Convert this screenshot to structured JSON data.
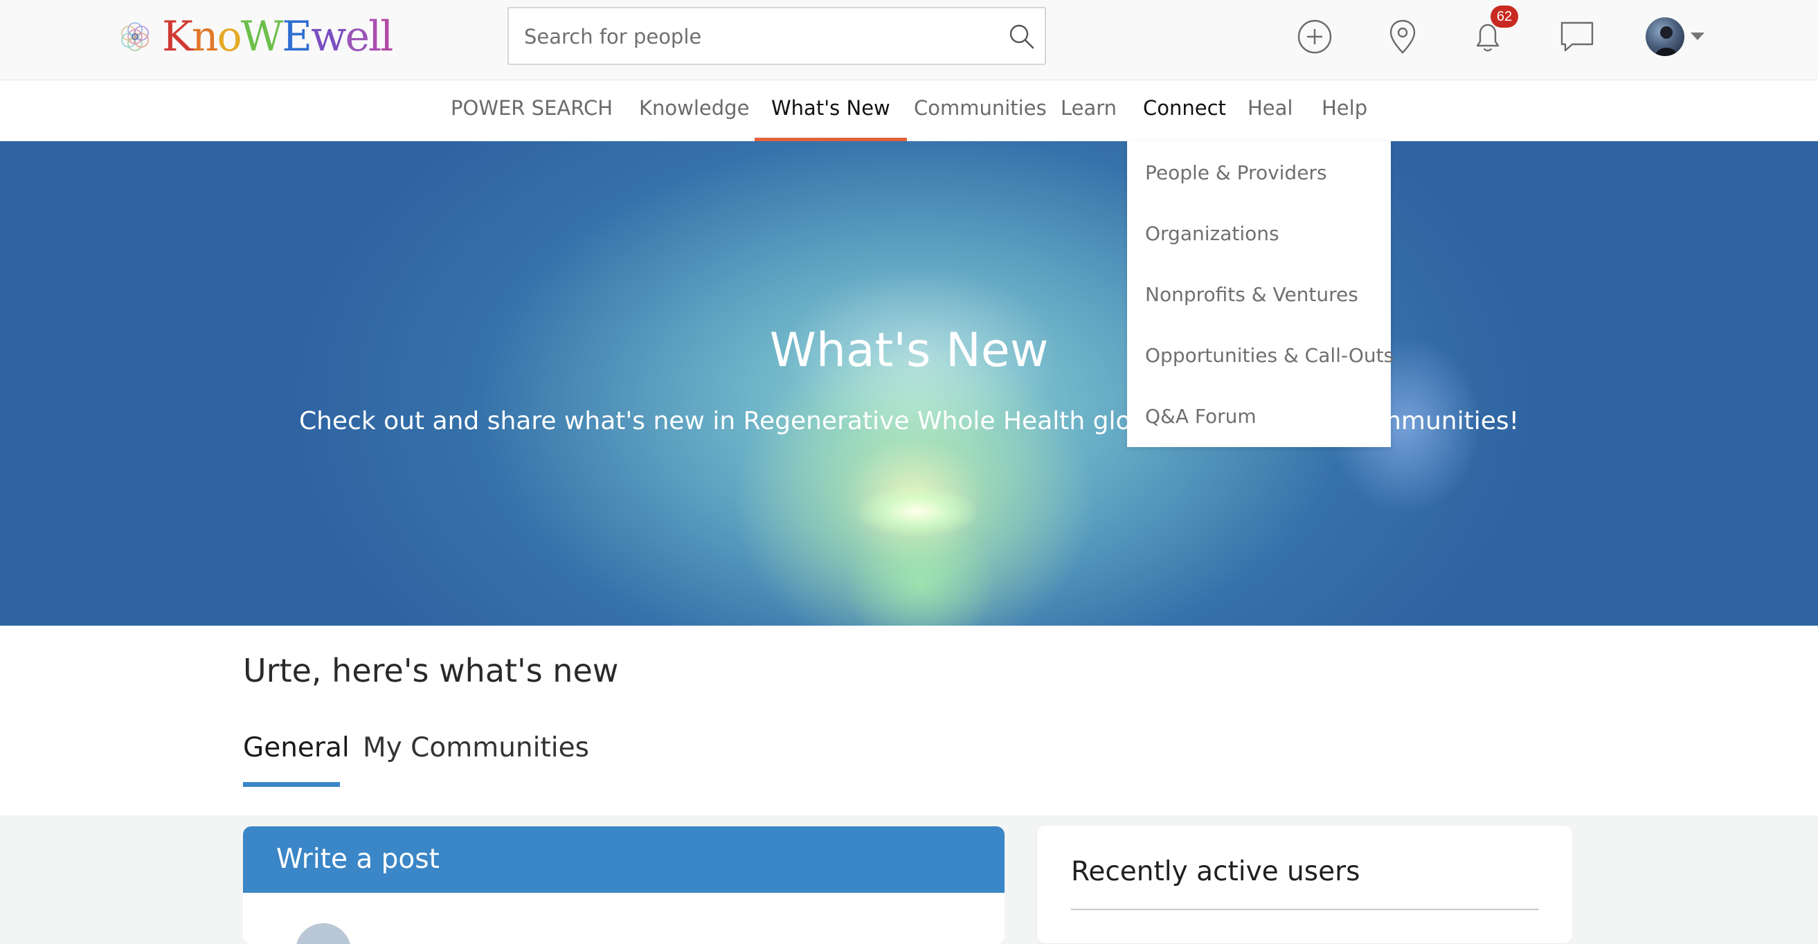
{
  "header": {
    "logo_text": "KnoWEwell",
    "search_placeholder": "Search for people",
    "notification_count": "62",
    "icons": [
      "plus-circle-icon",
      "location-pin-icon",
      "bell-icon",
      "chat-bubble-icon",
      "caret-down-icon"
    ]
  },
  "nav": {
    "items": [
      {
        "label": "POWER SEARCH"
      },
      {
        "label": "Knowledge"
      },
      {
        "label": "What's New"
      },
      {
        "label": "Communities"
      },
      {
        "label": "Learn"
      },
      {
        "label": "Connect"
      },
      {
        "label": "Heal"
      },
      {
        "label": "Help"
      }
    ],
    "active": "What's New",
    "open_menu": "Connect"
  },
  "dropdown": {
    "items": [
      {
        "label": "People & Providers"
      },
      {
        "label": "Organizations"
      },
      {
        "label": "Nonprofits & Ventures"
      },
      {
        "label": "Opportunities & Call-Outs"
      },
      {
        "label": "Q&A Forum"
      }
    ]
  },
  "hero": {
    "title": "What's New",
    "subtitle": "Check out and share what's new in Regenerative Whole Health globally and in your communities!"
  },
  "feed": {
    "greeting": "Urte, here's what's new",
    "tabs": [
      {
        "label": "General"
      },
      {
        "label": "My Communities"
      }
    ],
    "active_tab": "General"
  },
  "post_card": {
    "title": "Write a post"
  },
  "users_card": {
    "title": "Recently active users"
  },
  "colors": {
    "accent_blue": "#3a86c6",
    "nav_active_underline": "#e2623a",
    "badge_red": "#c82a21",
    "hero_blue": "#2f64a2"
  }
}
